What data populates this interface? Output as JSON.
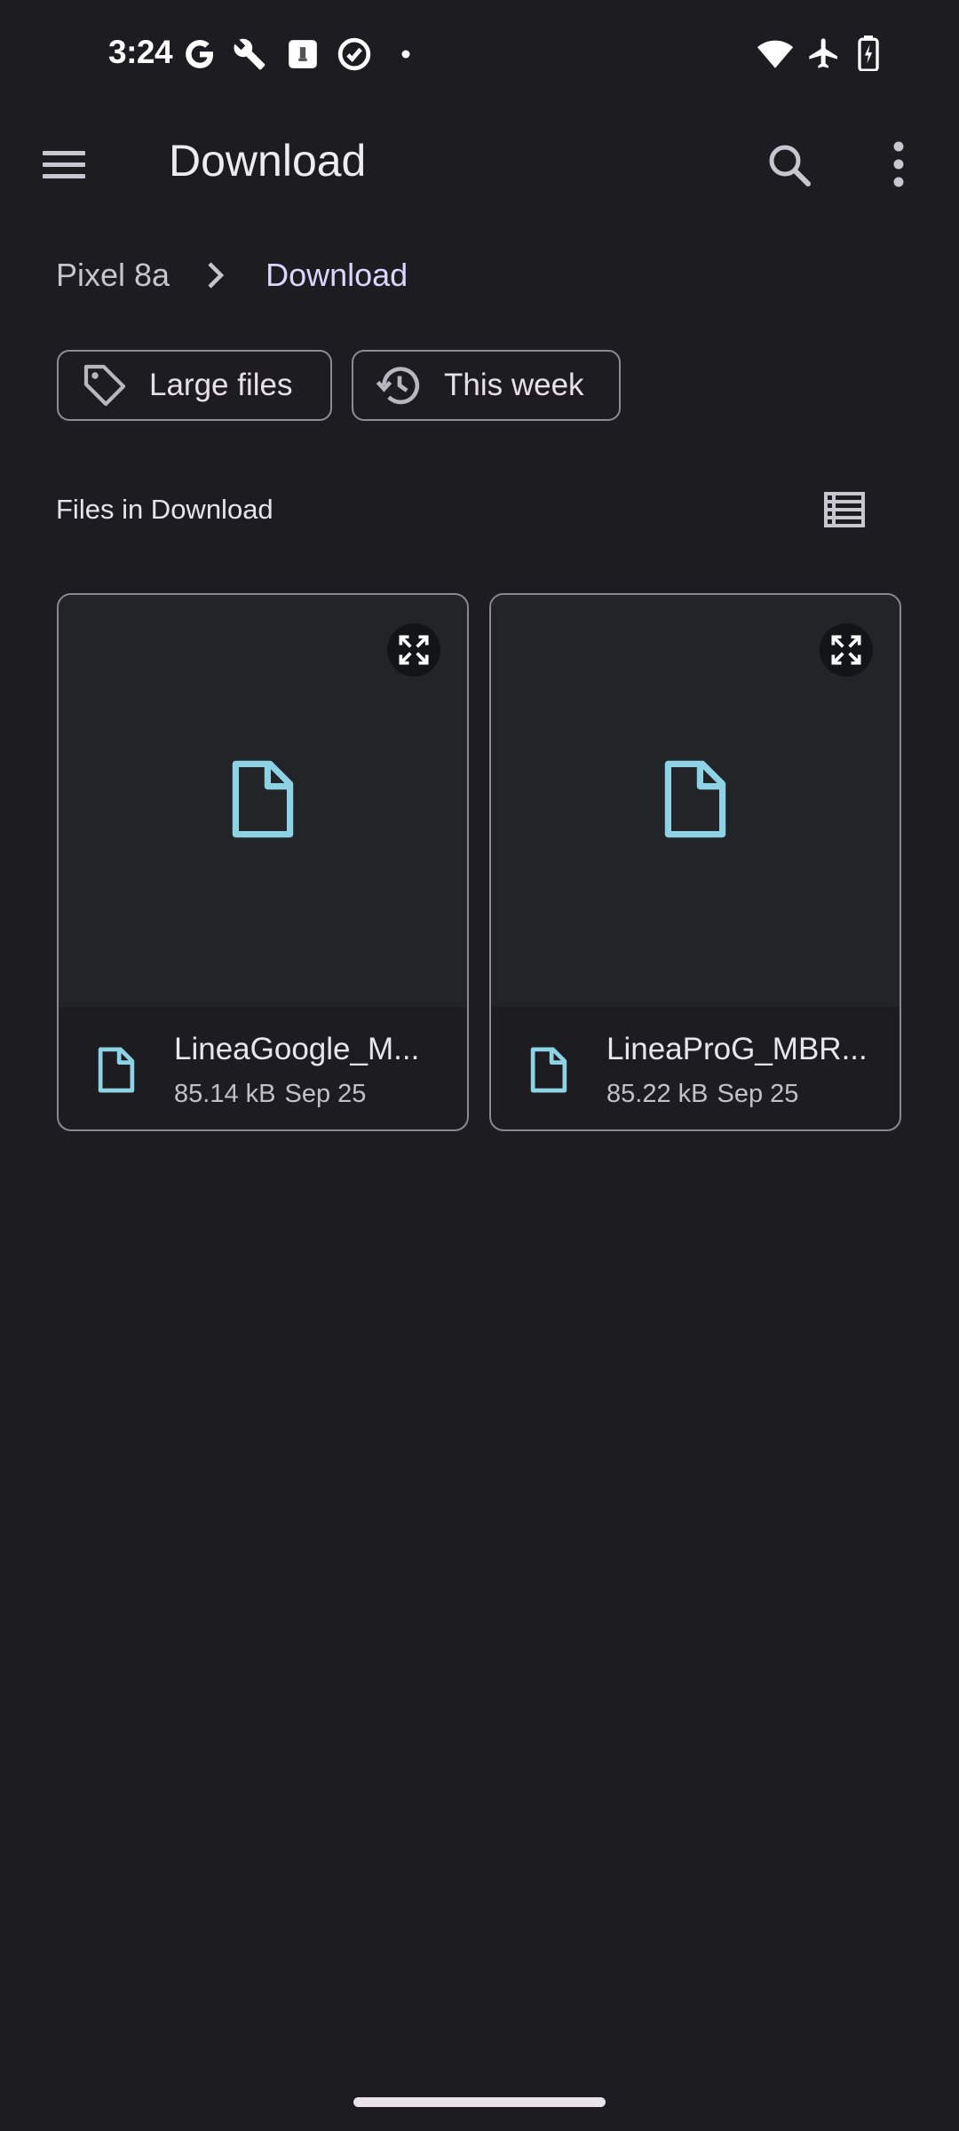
{
  "status_bar": {
    "time": "3:24",
    "left_icons": [
      "google-g-icon",
      "wrench-icon",
      "sim-card-icon",
      "check-circle-icon",
      "dot-icon"
    ],
    "right_icons": [
      "wifi-icon",
      "airplane-mode-icon",
      "battery-charging-icon"
    ]
  },
  "app_bar": {
    "title": "Download",
    "icons": [
      "menu-icon",
      "search-icon",
      "more-vert-icon"
    ]
  },
  "breadcrumb": {
    "root": "Pixel 8a",
    "current": "Download"
  },
  "chips": [
    {
      "label": "Large files",
      "icon": "label-tag-icon"
    },
    {
      "label": "This week",
      "icon": "history-icon"
    }
  ],
  "section": {
    "title": "Files in Download",
    "view_toggle_icon": "list-view-icon"
  },
  "files": [
    {
      "name": "LineaGoogle_M...",
      "size": "85.14 kB",
      "date": "Sep 25"
    },
    {
      "name": "LineaProG_MBR...",
      "size": "85.22 kB",
      "date": "Sep 25"
    }
  ],
  "colors": {
    "background": "#1d1c21",
    "thumbnail_background": "#222428",
    "accent_doc": "#8ed2e6",
    "breadcrumb_current": "#dcd6ff",
    "outline": "#8d8b93"
  }
}
